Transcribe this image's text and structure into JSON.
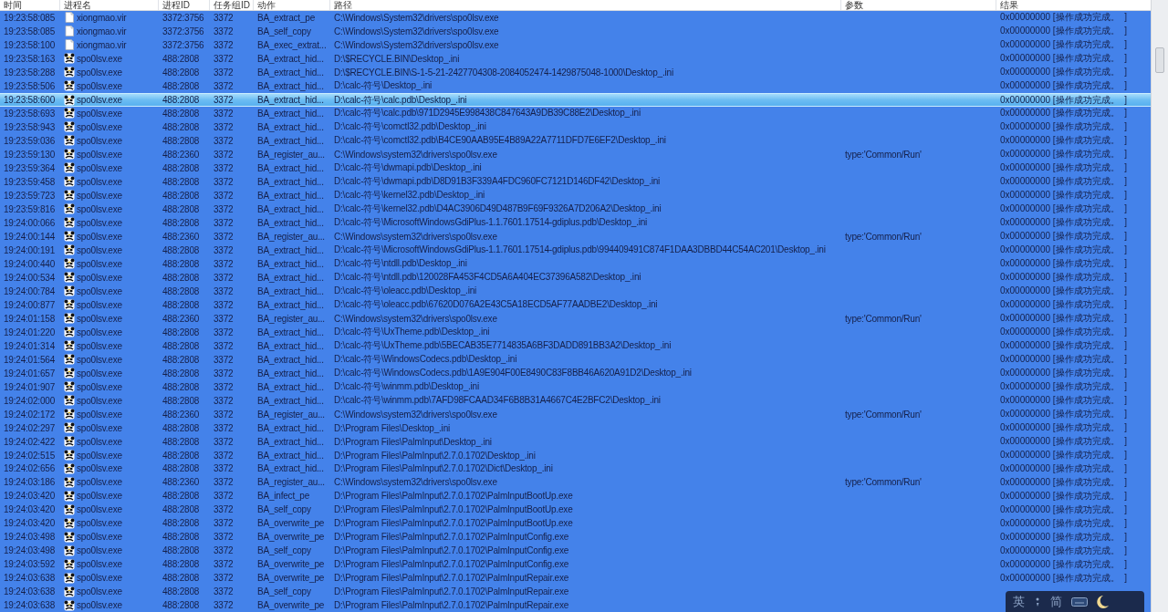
{
  "table": {
    "columns": [
      "时间",
      "进程名",
      "进程ID",
      "任务组ID",
      "动作",
      "路径",
      "参数",
      "结果"
    ],
    "rows": [
      {
        "kind": "file",
        "time": "19:23:58:085",
        "process": "xiongmao.vir",
        "pid": "3372:3756",
        "group": "3372",
        "action": "BA_extract_pe",
        "path": "C:\\Windows\\System32\\drivers\\spo0lsv.exe",
        "result": "0x00000000 [操作成功完成。  ]",
        "selected": true,
        "focused": false
      },
      {
        "kind": "file",
        "time": "19:23:58:085",
        "process": "xiongmao.vir",
        "pid": "3372:3756",
        "group": "3372",
        "action": "BA_self_copy",
        "path": "C:\\Windows\\System32\\drivers\\spo0lsv.exe",
        "result": "0x00000000 [操作成功完成。  ]",
        "selected": true,
        "focused": false
      },
      {
        "kind": "file",
        "time": "19:23:58:100",
        "process": "xiongmao.vir",
        "pid": "3372:3756",
        "group": "3372",
        "action": "BA_exec_extrat...",
        "path": "C:\\Windows\\System32\\drivers\\spo0lsv.exe",
        "result": "0x00000000 [操作成功完成。  ]",
        "selected": true,
        "focused": false
      },
      {
        "kind": "panda",
        "time": "19:23:58:163",
        "process": "spo0lsv.exe",
        "pid": "488:2808",
        "group": "3372",
        "action": "BA_extract_hid...",
        "path": "D:\\$RECYCLE.BIN\\Desktop_.ini",
        "result": "0x00000000 [操作成功完成。  ]",
        "selected": true,
        "focused": false
      },
      {
        "kind": "panda",
        "time": "19:23:58:288",
        "process": "spo0lsv.exe",
        "pid": "488:2808",
        "group": "3372",
        "action": "BA_extract_hid...",
        "path": "D:\\$RECYCLE.BIN\\S-1-5-21-2427704308-2084052474-1429875048-1000\\Desktop_.ini",
        "result": "0x00000000 [操作成功完成。  ]",
        "selected": true,
        "focused": false
      },
      {
        "kind": "panda",
        "time": "19:23:58:506",
        "process": "spo0lsv.exe",
        "pid": "488:2808",
        "group": "3372",
        "action": "BA_extract_hid...",
        "path": "D:\\calc-符号\\Desktop_.ini",
        "result": "0x00000000 [操作成功完成。  ]",
        "selected": true,
        "focused": false
      },
      {
        "kind": "panda",
        "time": "19:23:58:600",
        "process": "spo0lsv.exe",
        "pid": "488:2808",
        "group": "3372",
        "action": "BA_extract_hid...",
        "path": "D:\\calc-符号\\calc.pdb\\Desktop_.ini",
        "result": "0x00000000 [操作成功完成。  ]",
        "selected": true,
        "focused": true
      },
      {
        "kind": "panda",
        "time": "19:23:58:693",
        "process": "spo0lsv.exe",
        "pid": "488:2808",
        "group": "3372",
        "action": "BA_extract_hid...",
        "path": "D:\\calc-符号\\calc.pdb\\971D2945E998438C847643A9DB39C88E2\\Desktop_.ini",
        "result": "0x00000000 [操作成功完成。  ]",
        "selected": true,
        "focused": false
      },
      {
        "kind": "panda",
        "time": "19:23:58:943",
        "process": "spo0lsv.exe",
        "pid": "488:2808",
        "group": "3372",
        "action": "BA_extract_hid...",
        "path": "D:\\calc-符号\\comctl32.pdb\\Desktop_.ini",
        "result": "0x00000000 [操作成功完成。  ]",
        "selected": true,
        "focused": false
      },
      {
        "kind": "panda",
        "time": "19:23:59:036",
        "process": "spo0lsv.exe",
        "pid": "488:2808",
        "group": "3372",
        "action": "BA_extract_hid...",
        "path": "D:\\calc-符号\\comctl32.pdb\\B4CE90AAB95E4B89A22A7711DFD7E6EF2\\Desktop_.ini",
        "result": "0x00000000 [操作成功完成。  ]",
        "selected": true,
        "focused": false
      },
      {
        "kind": "panda",
        "time": "19:23:59:130",
        "process": "spo0lsv.exe",
        "pid": "488:2360",
        "group": "3372",
        "action": "BA_register_au...",
        "path": "C:\\Windows\\system32\\drivers\\spo0lsv.exe",
        "params": "type:'Common/Run'",
        "result": "0x00000000 [操作成功完成。  ]",
        "selected": true,
        "focused": false
      },
      {
        "kind": "panda",
        "time": "19:23:59:364",
        "process": "spo0lsv.exe",
        "pid": "488:2808",
        "group": "3372",
        "action": "BA_extract_hid...",
        "path": "D:\\calc-符号\\dwmapi.pdb\\Desktop_.ini",
        "result": "0x00000000 [操作成功完成。  ]",
        "selected": true,
        "focused": false
      },
      {
        "kind": "panda",
        "time": "19:23:59:458",
        "process": "spo0lsv.exe",
        "pid": "488:2808",
        "group": "3372",
        "action": "BA_extract_hid...",
        "path": "D:\\calc-符号\\dwmapi.pdb\\D8D91B3F339A4FDC960FC7121D146DF42\\Desktop_.ini",
        "result": "0x00000000 [操作成功完成。  ]",
        "selected": true,
        "focused": false
      },
      {
        "kind": "panda",
        "time": "19:23:59:723",
        "process": "spo0lsv.exe",
        "pid": "488:2808",
        "group": "3372",
        "action": "BA_extract_hid...",
        "path": "D:\\calc-符号\\kernel32.pdb\\Desktop_.ini",
        "result": "0x00000000 [操作成功完成。  ]",
        "selected": true,
        "focused": false
      },
      {
        "kind": "panda",
        "time": "19:23:59:816",
        "process": "spo0lsv.exe",
        "pid": "488:2808",
        "group": "3372",
        "action": "BA_extract_hid...",
        "path": "D:\\calc-符号\\kernel32.pdb\\D4AC3906D49D487B9F69F9326A7D206A2\\Desktop_.ini",
        "result": "0x00000000 [操作成功完成。  ]",
        "selected": true,
        "focused": false
      },
      {
        "kind": "panda",
        "time": "19:24:00:066",
        "process": "spo0lsv.exe",
        "pid": "488:2808",
        "group": "3372",
        "action": "BA_extract_hid...",
        "path": "D:\\calc-符号\\MicrosoftWindowsGdiPlus-1.1.7601.17514-gdiplus.pdb\\Desktop_.ini",
        "result": "0x00000000 [操作成功完成。  ]",
        "selected": true,
        "focused": false
      },
      {
        "kind": "panda",
        "time": "19:24:00:144",
        "process": "spo0lsv.exe",
        "pid": "488:2360",
        "group": "3372",
        "action": "BA_register_au...",
        "path": "C:\\Windows\\system32\\drivers\\spo0lsv.exe",
        "params": "type:'Common/Run'",
        "result": "0x00000000 [操作成功完成。  ]",
        "selected": true,
        "focused": false
      },
      {
        "kind": "panda",
        "time": "19:24:00:191",
        "process": "spo0lsv.exe",
        "pid": "488:2808",
        "group": "3372",
        "action": "BA_extract_hid...",
        "path": "D:\\calc-符号\\MicrosoftWindowsGdiPlus-1.1.7601.17514-gdiplus.pdb\\994409491C874F1DAA3DBBD44C54AC201\\Desktop_.ini",
        "result": "0x00000000 [操作成功完成。  ]",
        "selected": true,
        "focused": false
      },
      {
        "kind": "panda",
        "time": "19:24:00:440",
        "process": "spo0lsv.exe",
        "pid": "488:2808",
        "group": "3372",
        "action": "BA_extract_hid...",
        "path": "D:\\calc-符号\\ntdll.pdb\\Desktop_.ini",
        "result": "0x00000000 [操作成功完成。  ]",
        "selected": true,
        "focused": false
      },
      {
        "kind": "panda",
        "time": "19:24:00:534",
        "process": "spo0lsv.exe",
        "pid": "488:2808",
        "group": "3372",
        "action": "BA_extract_hid...",
        "path": "D:\\calc-符号\\ntdll.pdb\\120028FA453F4CD5A6A404EC37396A582\\Desktop_.ini",
        "result": "0x00000000 [操作成功完成。  ]",
        "selected": true,
        "focused": false
      },
      {
        "kind": "panda",
        "time": "19:24:00:784",
        "process": "spo0lsv.exe",
        "pid": "488:2808",
        "group": "3372",
        "action": "BA_extract_hid...",
        "path": "D:\\calc-符号\\oleacc.pdb\\Desktop_.ini",
        "result": "0x00000000 [操作成功完成。  ]",
        "selected": true,
        "focused": false
      },
      {
        "kind": "panda",
        "time": "19:24:00:877",
        "process": "spo0lsv.exe",
        "pid": "488:2808",
        "group": "3372",
        "action": "BA_extract_hid...",
        "path": "D:\\calc-符号\\oleacc.pdb\\67620D076A2E43C5A18ECD5AF77AADBE2\\Desktop_.ini",
        "result": "0x00000000 [操作成功完成。  ]",
        "selected": true,
        "focused": false
      },
      {
        "kind": "panda",
        "time": "19:24:01:158",
        "process": "spo0lsv.exe",
        "pid": "488:2360",
        "group": "3372",
        "action": "BA_register_au...",
        "path": "C:\\Windows\\system32\\drivers\\spo0lsv.exe",
        "params": "type:'Common/Run'",
        "result": "0x00000000 [操作成功完成。  ]",
        "selected": true,
        "focused": false
      },
      {
        "kind": "panda",
        "time": "19:24:01:220",
        "process": "spo0lsv.exe",
        "pid": "488:2808",
        "group": "3372",
        "action": "BA_extract_hid...",
        "path": "D:\\calc-符号\\UxTheme.pdb\\Desktop_.ini",
        "result": "0x00000000 [操作成功完成。  ]",
        "selected": true,
        "focused": false
      },
      {
        "kind": "panda",
        "time": "19:24:01:314",
        "process": "spo0lsv.exe",
        "pid": "488:2808",
        "group": "3372",
        "action": "BA_extract_hid...",
        "path": "D:\\calc-符号\\UxTheme.pdb\\5BECAB35E7714835A6BF3DADD891BB3A2\\Desktop_.ini",
        "result": "0x00000000 [操作成功完成。  ]",
        "selected": true,
        "focused": false
      },
      {
        "kind": "panda",
        "time": "19:24:01:564",
        "process": "spo0lsv.exe",
        "pid": "488:2808",
        "group": "3372",
        "action": "BA_extract_hid...",
        "path": "D:\\calc-符号\\WindowsCodecs.pdb\\Desktop_.ini",
        "result": "0x00000000 [操作成功完成。  ]",
        "selected": true,
        "focused": false
      },
      {
        "kind": "panda",
        "time": "19:24:01:657",
        "process": "spo0lsv.exe",
        "pid": "488:2808",
        "group": "3372",
        "action": "BA_extract_hid...",
        "path": "D:\\calc-符号\\WindowsCodecs.pdb\\1A9E904F00E8490C83F8BB46A620A91D2\\Desktop_.ini",
        "result": "0x00000000 [操作成功完成。  ]",
        "selected": true,
        "focused": false
      },
      {
        "kind": "panda",
        "time": "19:24:01:907",
        "process": "spo0lsv.exe",
        "pid": "488:2808",
        "group": "3372",
        "action": "BA_extract_hid...",
        "path": "D:\\calc-符号\\winmm.pdb\\Desktop_.ini",
        "result": "0x00000000 [操作成功完成。  ]",
        "selected": true,
        "focused": false
      },
      {
        "kind": "panda",
        "time": "19:24:02:000",
        "process": "spo0lsv.exe",
        "pid": "488:2808",
        "group": "3372",
        "action": "BA_extract_hid...",
        "path": "D:\\calc-符号\\winmm.pdb\\7AFD98FCAAD34F6B8B31A4667C4E2BFC2\\Desktop_.ini",
        "result": "0x00000000 [操作成功完成。  ]",
        "selected": true,
        "focused": false
      },
      {
        "kind": "panda",
        "time": "19:24:02:172",
        "process": "spo0lsv.exe",
        "pid": "488:2360",
        "group": "3372",
        "action": "BA_register_au...",
        "path": "C:\\Windows\\system32\\drivers\\spo0lsv.exe",
        "params": "type:'Common/Run'",
        "result": "0x00000000 [操作成功完成。  ]",
        "selected": true,
        "focused": false
      },
      {
        "kind": "panda",
        "time": "19:24:02:297",
        "process": "spo0lsv.exe",
        "pid": "488:2808",
        "group": "3372",
        "action": "BA_extract_hid...",
        "path": "D:\\Program Files\\Desktop_.ini",
        "result": "0x00000000 [操作成功完成。  ]",
        "selected": true,
        "focused": false
      },
      {
        "kind": "panda",
        "time": "19:24:02:422",
        "process": "spo0lsv.exe",
        "pid": "488:2808",
        "group": "3372",
        "action": "BA_extract_hid...",
        "path": "D:\\Program Files\\PalmInput\\Desktop_.ini",
        "result": "0x00000000 [操作成功完成。  ]",
        "selected": true,
        "focused": false
      },
      {
        "kind": "panda",
        "time": "19:24:02:515",
        "process": "spo0lsv.exe",
        "pid": "488:2808",
        "group": "3372",
        "action": "BA_extract_hid...",
        "path": "D:\\Program Files\\PalmInput\\2.7.0.1702\\Desktop_.ini",
        "result": "0x00000000 [操作成功完成。  ]",
        "selected": true,
        "focused": false
      },
      {
        "kind": "panda",
        "time": "19:24:02:656",
        "process": "spo0lsv.exe",
        "pid": "488:2808",
        "group": "3372",
        "action": "BA_extract_hid...",
        "path": "D:\\Program Files\\PalmInput\\2.7.0.1702\\Dict\\Desktop_.ini",
        "result": "0x00000000 [操作成功完成。  ]",
        "selected": true,
        "focused": false
      },
      {
        "kind": "panda",
        "time": "19:24:03:186",
        "process": "spo0lsv.exe",
        "pid": "488:2360",
        "group": "3372",
        "action": "BA_register_au...",
        "path": "C:\\Windows\\system32\\drivers\\spo0lsv.exe",
        "params": "type:'Common/Run'",
        "result": "0x00000000 [操作成功完成。  ]",
        "selected": true,
        "focused": false
      },
      {
        "kind": "panda",
        "time": "19:24:03:420",
        "process": "spo0lsv.exe",
        "pid": "488:2808",
        "group": "3372",
        "action": "BA_infect_pe",
        "path": "D:\\Program Files\\PalmInput\\2.7.0.1702\\PalmInputBootUp.exe",
        "result": "0x00000000 [操作成功完成。  ]",
        "selected": true,
        "focused": false
      },
      {
        "kind": "panda",
        "time": "19:24:03:420",
        "process": "spo0lsv.exe",
        "pid": "488:2808",
        "group": "3372",
        "action": "BA_self_copy",
        "path": "D:\\Program Files\\PalmInput\\2.7.0.1702\\PalmInputBootUp.exe",
        "result": "0x00000000 [操作成功完成。  ]",
        "selected": true,
        "focused": false
      },
      {
        "kind": "panda",
        "time": "19:24:03:420",
        "process": "spo0lsv.exe",
        "pid": "488:2808",
        "group": "3372",
        "action": "BA_overwrite_pe",
        "path": "D:\\Program Files\\PalmInput\\2.7.0.1702\\PalmInputBootUp.exe",
        "result": "0x00000000 [操作成功完成。  ]",
        "selected": true,
        "focused": false
      },
      {
        "kind": "panda",
        "time": "19:24:03:498",
        "process": "spo0lsv.exe",
        "pid": "488:2808",
        "group": "3372",
        "action": "BA_overwrite_pe",
        "path": "D:\\Program Files\\PalmInput\\2.7.0.1702\\PalmInputConfig.exe",
        "result": "0x00000000 [操作成功完成。  ]",
        "selected": true,
        "focused": false
      },
      {
        "kind": "panda",
        "time": "19:24:03:498",
        "process": "spo0lsv.exe",
        "pid": "488:2808",
        "group": "3372",
        "action": "BA_self_copy",
        "path": "D:\\Program Files\\PalmInput\\2.7.0.1702\\PalmInputConfig.exe",
        "result": "0x00000000 [操作成功完成。  ]",
        "selected": true,
        "focused": false
      },
      {
        "kind": "panda",
        "time": "19:24:03:592",
        "process": "spo0lsv.exe",
        "pid": "488:2808",
        "group": "3372",
        "action": "BA_overwrite_pe",
        "path": "D:\\Program Files\\PalmInput\\2.7.0.1702\\PalmInputConfig.exe",
        "result": "0x00000000 [操作成功完成。  ]",
        "selected": true,
        "focused": false
      },
      {
        "kind": "panda",
        "time": "19:24:03:638",
        "process": "spo0lsv.exe",
        "pid": "488:2808",
        "group": "3372",
        "action": "BA_overwrite_pe",
        "path": "D:\\Program Files\\PalmInput\\2.7.0.1702\\PalmInputRepair.exe",
        "result": "0x00000000 [操作成功完成。  ]",
        "selected": true,
        "focused": false
      },
      {
        "kind": "panda",
        "time": "19:24:03:638",
        "process": "spo0lsv.exe",
        "pid": "488:2808",
        "group": "3372",
        "action": "BA_self_copy",
        "path": "D:\\Program Files\\PalmInput\\2.7.0.1702\\PalmInputRepair.exe",
        "selected": true,
        "focused": false
      },
      {
        "kind": "panda",
        "time": "19:24:03:638",
        "process": "spo0lsv.exe",
        "pid": "488:2808",
        "group": "3372",
        "action": "BA_overwrite_pe",
        "path": "D:\\Program Files\\PalmInput\\2.7.0.1702\\PalmInputRepair.exe",
        "selected": true,
        "focused": false
      }
    ]
  },
  "ime_bar": {
    "language": "英",
    "script": "简"
  }
}
